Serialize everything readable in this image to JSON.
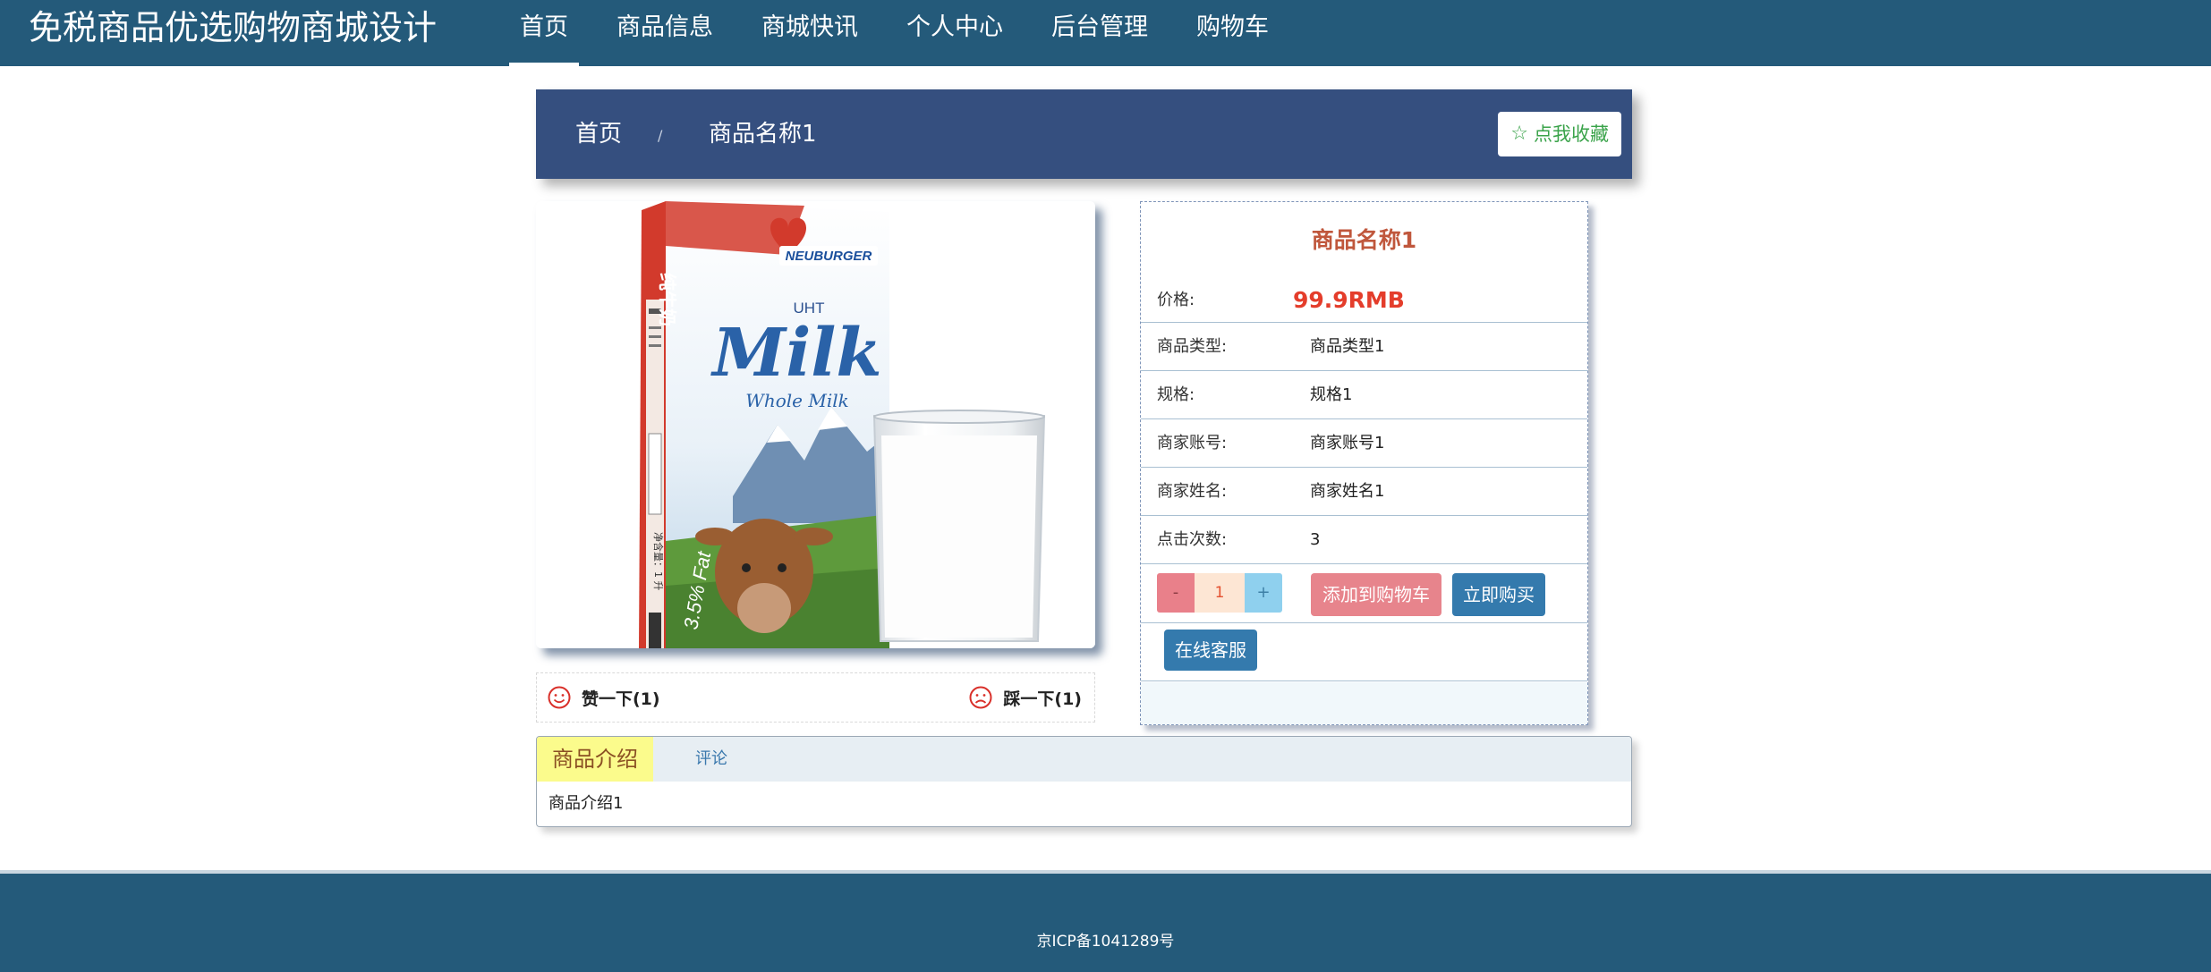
{
  "header": {
    "site_title": "免税商品优选购物商城设计",
    "nav": [
      {
        "label": "首页",
        "active": true
      },
      {
        "label": "商品信息"
      },
      {
        "label": "商城快讯"
      },
      {
        "label": "个人中心"
      },
      {
        "label": "后台管理"
      },
      {
        "label": "购物车"
      }
    ]
  },
  "breadcrumb": {
    "home": "首页",
    "separator": "/",
    "current": "商品名称1",
    "favorite_label": "点我收藏",
    "favorite_icon": "star-outline-icon"
  },
  "product_image": {
    "brand": "NEUBURGER",
    "uht": "UHT",
    "word": "Milk",
    "sub": "Whole Milk",
    "fat": "3.5% Fat",
    "side_text": "纯牛奶",
    "net": "净含量：1 升"
  },
  "likes": {
    "up_label": "赞一下(1)",
    "down_label": "踩一下(1)"
  },
  "product": {
    "name": "商品名称1",
    "price_label": "价格:",
    "price": "99.9RMB",
    "fields": [
      {
        "label": "商品类型:",
        "value": "商品类型1"
      },
      {
        "label": "规格:",
        "value": "规格1"
      },
      {
        "label": "商家账号:",
        "value": "商家账号1"
      },
      {
        "label": "商家姓名:",
        "value": "商家姓名1"
      },
      {
        "label": "点击次数:",
        "value": "3"
      }
    ],
    "quantity": "1",
    "minus": "-",
    "plus": "+",
    "add_to_cart": "添加到购物车",
    "buy_now": "立即购买",
    "online_service": "在线客服"
  },
  "tabs": {
    "intro_tab": "商品介绍",
    "comments_tab": "评论",
    "intro_content": "商品介绍1"
  },
  "footer": {
    "icp": "京ICP备1041289号"
  },
  "colors": {
    "nav_bg": "#245a7a",
    "breadcrumb_bg": "#354f7f",
    "price": "#e43d2b",
    "product_name": "#c0573c",
    "primary_button": "#347aad",
    "cart_button": "#e7848c"
  }
}
